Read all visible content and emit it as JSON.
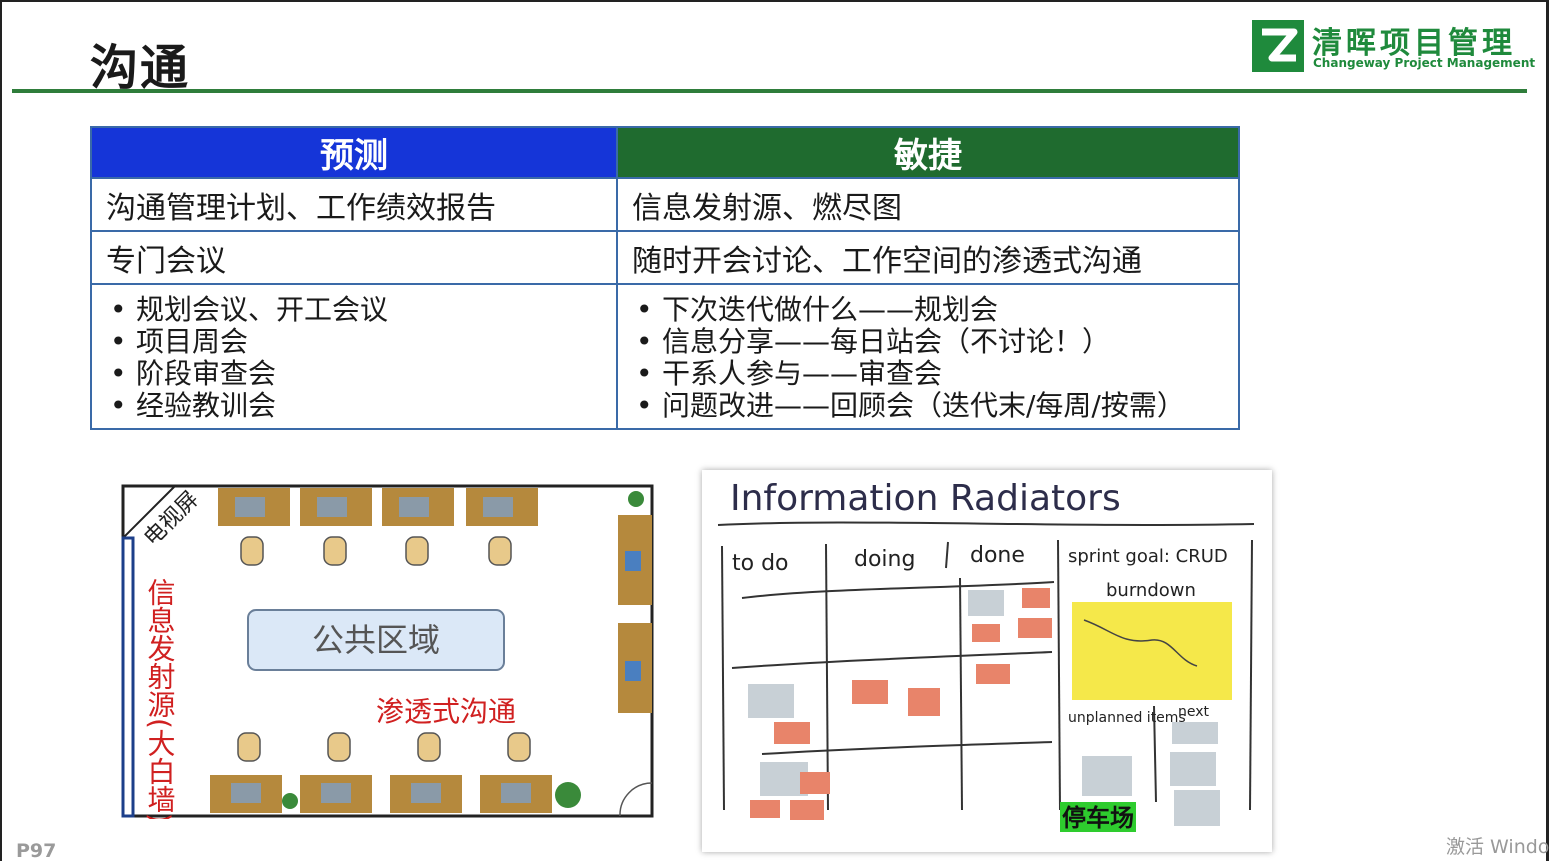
{
  "title": "沟通",
  "logo": {
    "name": "清晖项目管理",
    "tagline": "Changeway Project Management"
  },
  "table": {
    "headers": {
      "predictive": "预测",
      "agile": "敏捷"
    },
    "rows": [
      {
        "predictive": "沟通管理计划、工作绩效报告",
        "agile": "信息发射源、燃尽图"
      },
      {
        "predictive": "专门会议",
        "agile": "随时开会讨论、工作空间的渗透式沟通"
      }
    ],
    "predictive_bullets": [
      "规划会议、开工会议",
      "项目周会",
      "阶段审查会",
      "经验教训会"
    ],
    "agile_bullets": [
      "下次迭代做什么——规划会",
      "信息分享——每日站会（不讨论！）",
      "干系人参与——审查会",
      "问题改进——回顾会（迭代末/每周/按需）"
    ]
  },
  "floorplan": {
    "tv_label": "电视屏",
    "wall_label": "信息发射源(大白墙)",
    "common_area": "公共区域",
    "osmotic": "渗透式沟通",
    "colors": {
      "desk": "#b5893d",
      "chair": "#e8c98a",
      "common_fill": "#dbe8f7",
      "red_text": "#d02020"
    }
  },
  "radiator": {
    "title": "Information Radiators",
    "columns": [
      "to do",
      "doing",
      "done",
      "sprint goal: CRUD"
    ],
    "burndown": "burndown",
    "unplanned": "unplanned items",
    "next": "next",
    "parking": "停车场"
  },
  "page_number": "P97",
  "watermark": "激活 Windo"
}
